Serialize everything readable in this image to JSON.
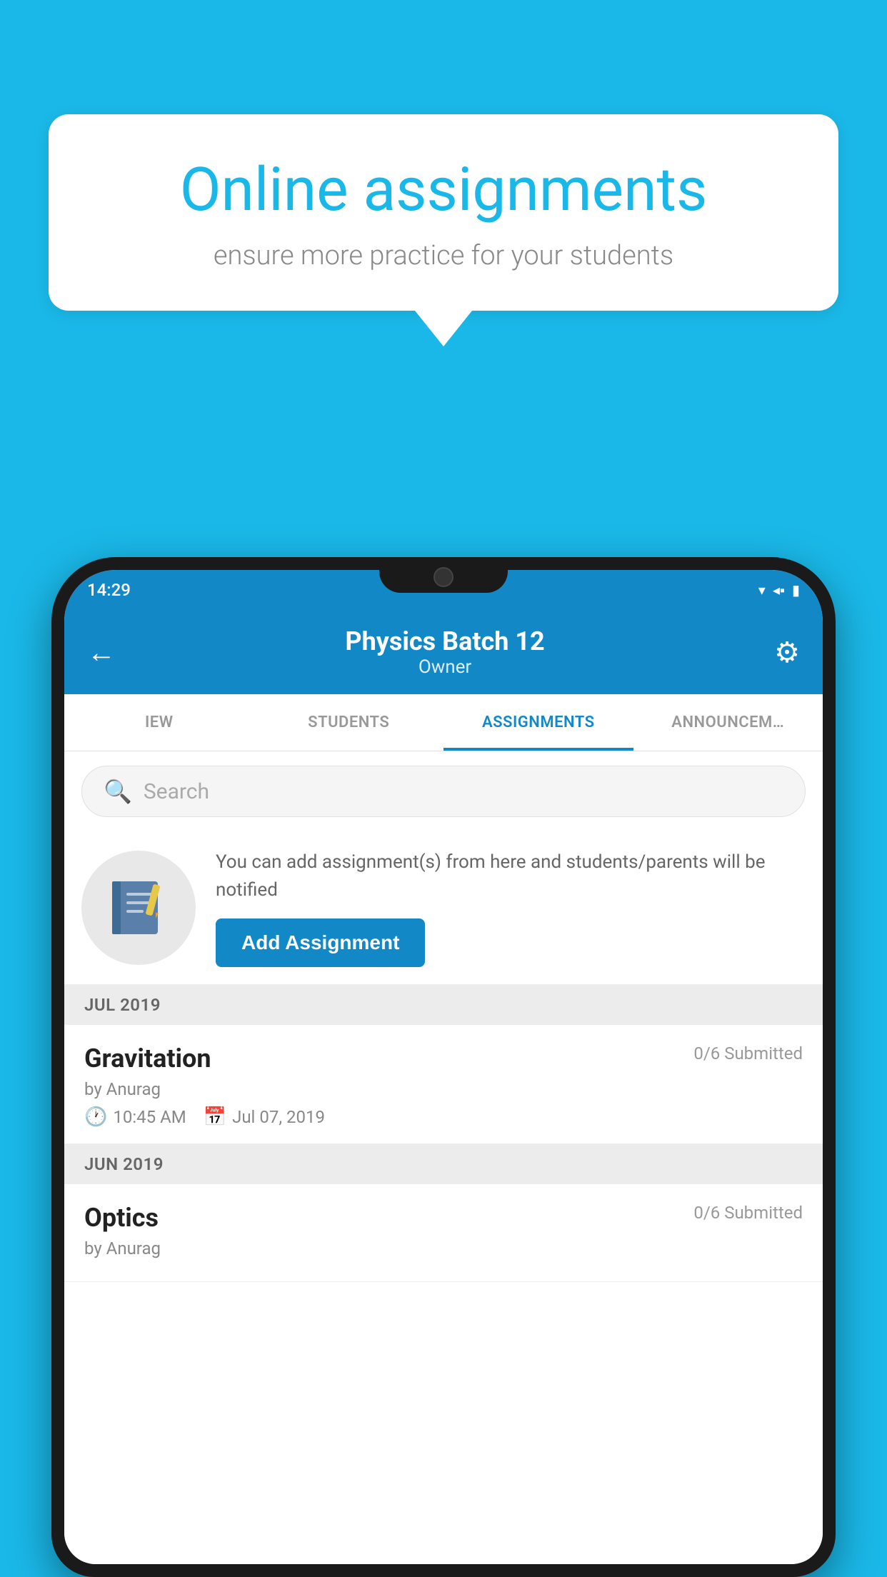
{
  "background_color": "#1ab8e8",
  "speech_bubble": {
    "title": "Online assignments",
    "subtitle": "ensure more practice for your students"
  },
  "status_bar": {
    "time": "14:29",
    "icons": "▼◀▐"
  },
  "header": {
    "title": "Physics Batch 12",
    "subtitle": "Owner",
    "back_label": "←",
    "gear_label": "⚙"
  },
  "tabs": [
    {
      "label": "IEW",
      "active": false
    },
    {
      "label": "STUDENTS",
      "active": false
    },
    {
      "label": "ASSIGNMENTS",
      "active": true
    },
    {
      "label": "ANNOUNCEM…",
      "active": false
    }
  ],
  "search": {
    "placeholder": "Search"
  },
  "promo": {
    "description": "You can add assignment(s) from here and students/parents will be notified",
    "button_label": "Add Assignment"
  },
  "sections": [
    {
      "month_label": "JUL 2019",
      "assignments": [
        {
          "title": "Gravitation",
          "submitted": "0/6 Submitted",
          "by": "by Anurag",
          "time": "10:45 AM",
          "date": "Jul 07, 2019"
        }
      ]
    },
    {
      "month_label": "JUN 2019",
      "assignments": [
        {
          "title": "Optics",
          "submitted": "0/6 Submitted",
          "by": "by Anurag",
          "time": "",
          "date": ""
        }
      ]
    }
  ]
}
